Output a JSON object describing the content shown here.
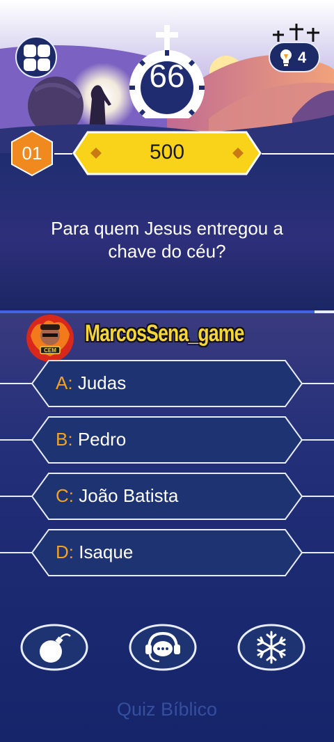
{
  "header": {
    "timer": "66",
    "hints": {
      "count": "4",
      "icon": "lightbulb-icon"
    },
    "level": "01",
    "score": "500"
  },
  "question": {
    "text": "Para quem Jesus entregou a chave do céu?"
  },
  "player": {
    "name": "MarcosSena_game",
    "avatar_badge": "CEM"
  },
  "answers": [
    {
      "letter": "A:",
      "text": "Judas"
    },
    {
      "letter": "B:",
      "text": "Pedro"
    },
    {
      "letter": "C:",
      "text": "João Batista"
    },
    {
      "letter": "D:",
      "text": "Isaque"
    }
  ],
  "powerups": [
    {
      "name": "bomb-icon"
    },
    {
      "name": "headset-chat-icon"
    },
    {
      "name": "snowflake-icon"
    }
  ],
  "footer": {
    "text": "Quiz Bíblico"
  },
  "colors": {
    "accent": "#f2a221",
    "score_bar": "#f9d21a",
    "level_badge": "#f08a1e",
    "panel": "#1d2a68"
  }
}
